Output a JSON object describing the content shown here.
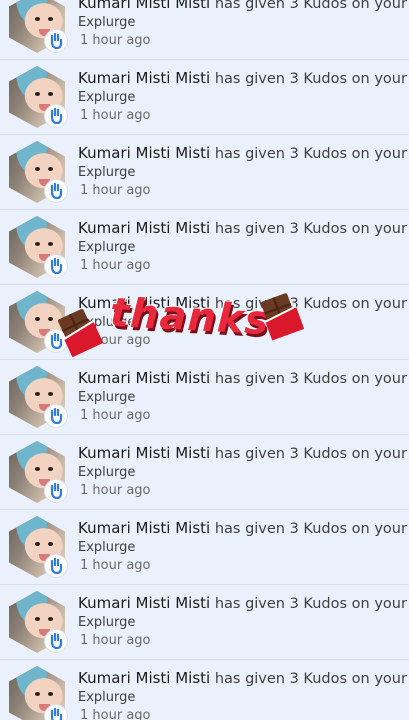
{
  "notifications": [
    {
      "name": "Kumari Misti Misti",
      "action": "has given 3 Kudos on your",
      "target": "Explurge",
      "time": "1 hour ago"
    },
    {
      "name": "Kumari Misti Misti",
      "action": "has given 3 Kudos on your",
      "target": "Explurge",
      "time": "1 hour ago"
    },
    {
      "name": "Kumari Misti Misti",
      "action": "has given 3 Kudos on your",
      "target": "Explurge",
      "time": "1 hour ago"
    },
    {
      "name": "Kumari Misti Misti",
      "action": "has given 3 Kudos on your",
      "target": "Explurge",
      "time": "1 hour ago"
    },
    {
      "name": "Kumari Misti Misti",
      "action": "has given 3 Kudos on your",
      "target": "Explurge",
      "time": "1 hour ago"
    },
    {
      "name": "Kumari Misti Misti",
      "action": "has given 3 Kudos on your",
      "target": "Explurge",
      "time": "1 hour ago"
    },
    {
      "name": "Kumari Misti Misti",
      "action": "has given 3 Kudos on your",
      "target": "Explurge",
      "time": "1 hour ago"
    },
    {
      "name": "Kumari Misti Misti",
      "action": "has given 3 Kudos on your",
      "target": "Explurge",
      "time": "1 hour ago"
    },
    {
      "name": "Kumari Misti Misti",
      "action": "has given 3 Kudos on your",
      "target": "Explurge",
      "time": "1 hour ago"
    },
    {
      "name": "Kumari Misti Misti",
      "action": "has given 3 Kudos on your",
      "target": "Explurge",
      "time": "1 hour ago"
    }
  ],
  "overlay": {
    "text": "thanks",
    "sticker_icon": "chocolate-bar-icon"
  },
  "badge_icon": "kudos-hand-icon",
  "colors": {
    "background": "#e9f0fb",
    "badge_blue": "#2f7be0",
    "thanks_red": "#e8293d"
  }
}
